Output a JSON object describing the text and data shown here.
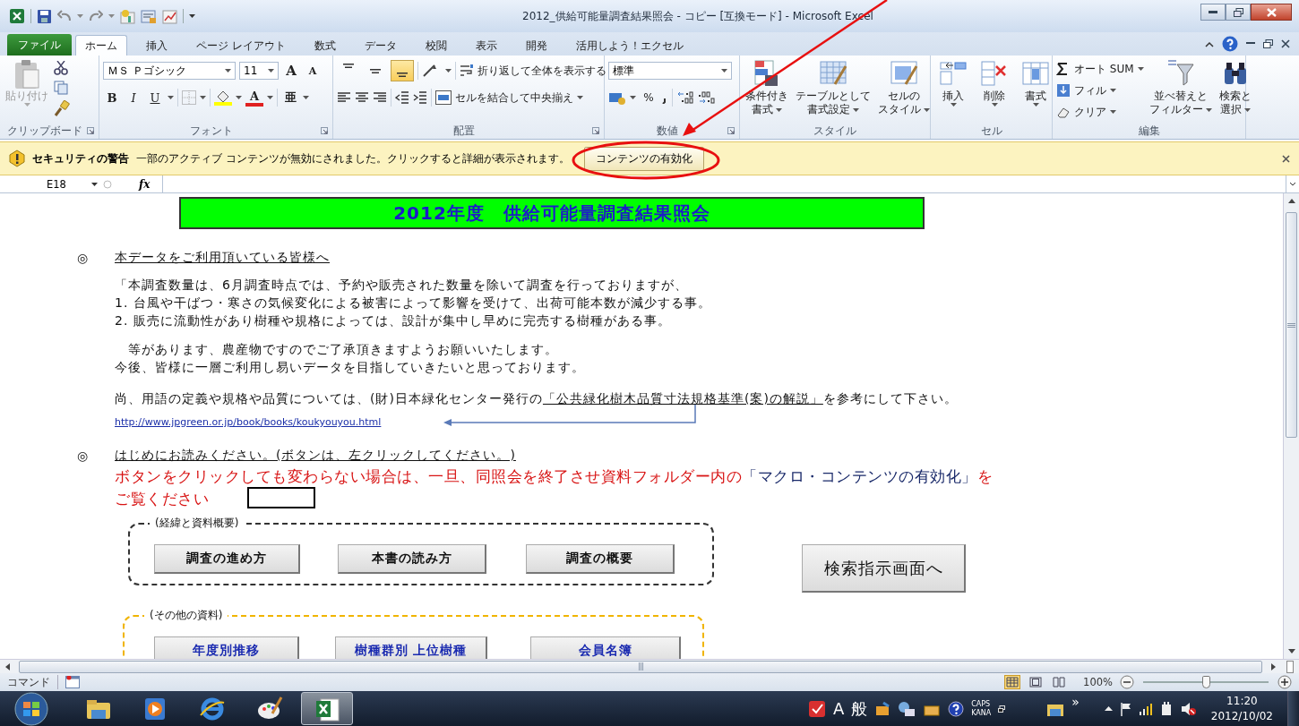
{
  "window": {
    "title": "2012_供給可能量調査結果照会 - コピー [互換モード] - Microsoft Excel"
  },
  "ribbon_tabs": [
    {
      "label": "ファイル",
      "kind": "file",
      "selected": false
    },
    {
      "label": "ホーム",
      "kind": "tab",
      "selected": true
    },
    {
      "label": "挿入",
      "kind": "tab",
      "selected": false
    },
    {
      "label": "ページ レイアウト",
      "kind": "tab",
      "selected": false
    },
    {
      "label": "数式",
      "kind": "tab",
      "selected": false
    },
    {
      "label": "データ",
      "kind": "tab",
      "selected": false
    },
    {
      "label": "校閲",
      "kind": "tab",
      "selected": false
    },
    {
      "label": "表示",
      "kind": "tab",
      "selected": false
    },
    {
      "label": "開発",
      "kind": "tab",
      "selected": false
    },
    {
      "label": "活用しよう！エクセル",
      "kind": "tab",
      "selected": false
    }
  ],
  "ribbon_groups": [
    {
      "kind": "clipboard",
      "name": "クリップボード",
      "paste_label": "貼り付け",
      "paste_disabled": true
    },
    {
      "kind": "font",
      "name": "フォント",
      "font_name": "ＭＳ Ｐゴシック",
      "font_size": "11",
      "grow_font": "A",
      "shrink_font": "A",
      "bold": "B",
      "italic": "I",
      "underline": "U",
      "font_color": "A",
      "phonetic": "亜"
    },
    {
      "kind": "alignment",
      "name": "配置",
      "vertical_align": [
        {
          "selected": false
        },
        {
          "selected": false
        },
        {
          "selected": true
        }
      ],
      "wrap_text": "折り返して全体を表示する",
      "merge_center": "セルを結合して中央揃え"
    },
    {
      "kind": "number",
      "name": "数値",
      "format": "標準",
      "percent": "%"
    },
    {
      "kind": "styles",
      "name": "スタイル",
      "buttons": [
        {
          "lines": [
            "条件付き",
            "書式"
          ]
        },
        {
          "lines": [
            "テーブルとして",
            "書式設定"
          ]
        },
        {
          "lines": [
            "セルの",
            "スタイル"
          ]
        }
      ]
    },
    {
      "kind": "cells",
      "name": "セル",
      "buttons": [
        "挿入",
        "削除",
        "書式"
      ]
    },
    {
      "kind": "editing",
      "name": "編集",
      "small": [
        "オート SUM",
        "フィル",
        "クリア"
      ],
      "large": [
        {
          "lines": [
            "並べ替えと",
            "フィルター"
          ]
        },
        {
          "lines": [
            "検索と",
            "選択"
          ]
        }
      ]
    }
  ],
  "security_bar": {
    "title": "セキュリティの警告",
    "message": "一部のアクティブ コンテンツが無効にされました。クリックすると詳細が表示されます。",
    "button": "コンテンツの有効化"
  },
  "formula_bar": {
    "name_box": "E18",
    "function_label": "fx"
  },
  "annotations": {
    "highlight_ellipse": true,
    "pointer_arrow": true
  },
  "sheet": {
    "banner": "2012年度　供給可能量調査結果照会",
    "notice": {
      "bullet": "◎",
      "heading": "本データをご利用頂いている皆様へ",
      "paragraphs": [
        [
          "「本調査数量は、6月調査時点では、予約や販売された数量を除いて調査を行っておりますが、",
          "1. 台風や干ばつ・寒さの気候変化による被害によって影響を受けて、出荷可能本数が減少する事。",
          "2. 販売に流動性があり樹種や規格によっては、設計が集中し早めに完売する樹種がある事。"
        ],
        [
          "　等があります、農産物ですのでご了承頂きますようお願いいたします。",
          "今後、皆様に一層ご利用し易いデータを目指していきたいと思っております。"
        ]
      ],
      "reference": {
        "before": "尚、用語の定義や規格や品質については、(財)日本緑化センター発行の",
        "underlined": "「公共緑化樹木品質寸法規格基準(案)の解説」",
        "after": "を参考にして下さい。"
      },
      "url": "http://www.jpgreen.or.jp/book/books/koukyouyou.html"
    },
    "guide": {
      "bullet": "◎",
      "heading": "はじめにお読みください。(ボタンは、左クリックしてください。)",
      "warning_lines": [
        [
          {
            "text": "ボタンをクリックしても変わらない場合は、一旦、同照会を終了させ資料フォルダー内の",
            "kind": "alert"
          },
          {
            "text": "「マクロ・コンテンツの有効化」",
            "kind": "reference"
          },
          {
            "text": "を",
            "kind": "alert"
          }
        ],
        [
          {
            "text": "ご覧ください",
            "kind": "alert"
          }
        ]
      ]
    },
    "groups": [
      {
        "kind": "main",
        "label": "(経緯と資料概要)",
        "buttons": [
          "調査の進め方",
          "本書の読み方",
          "調査の概要"
        ]
      },
      {
        "kind": "other",
        "label": "(その他の資料)",
        "buttons": [
          "年度別推移",
          "樹種群別 上位樹種",
          "会員名簿"
        ]
      }
    ],
    "search_button": "検索指示画面へ"
  },
  "status_bar": {
    "mode": "コマンド",
    "views": [
      {
        "selected": true
      },
      {
        "selected": false
      },
      {
        "selected": false
      }
    ],
    "zoom": "100%",
    "zoom_slider": {
      "level": 0.5
    }
  },
  "taskbar": {
    "apps": [
      {
        "kind": "folder",
        "selected": false
      },
      {
        "kind": "media",
        "selected": false
      },
      {
        "kind": "browser",
        "selected": false
      },
      {
        "kind": "paint",
        "selected": false
      },
      {
        "kind": "spreadsheet",
        "selected": true
      }
    ],
    "ime_mode": "A",
    "ime_kana": "般",
    "caps": "CAPS",
    "kana": "KANA",
    "overflow": "»",
    "time": "11:20",
    "date": "2012/10/02"
  }
}
